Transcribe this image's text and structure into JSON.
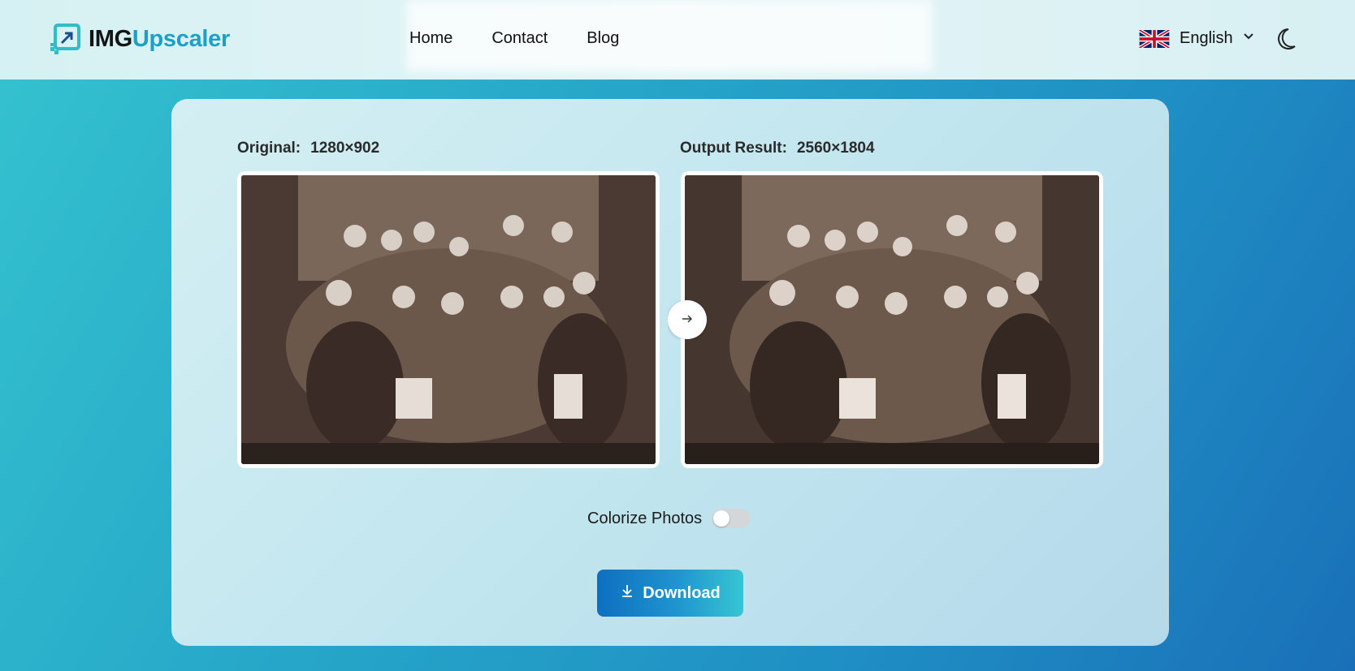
{
  "header": {
    "logo": {
      "part1": "IMG",
      "part2": "Upscaler"
    },
    "nav": [
      {
        "label": "Home"
      },
      {
        "label": "Contact"
      },
      {
        "label": "Blog"
      }
    ],
    "language": {
      "label": "English",
      "flag_icon": "uk-flag-icon"
    },
    "theme_icon": "moon-icon"
  },
  "comparison": {
    "original": {
      "label": "Original:",
      "dims": "1280×902"
    },
    "output": {
      "label": "Output Result:",
      "dims": "2560×1804"
    }
  },
  "colorize": {
    "label": "Colorize Photos",
    "enabled": false
  },
  "download": {
    "label": "Download",
    "icon": "download-icon"
  },
  "colors": {
    "accent": "#1da0c8",
    "button_start": "#0e6fc0",
    "button_end": "#36c6d3",
    "toggle_off": "#d3d7da"
  }
}
